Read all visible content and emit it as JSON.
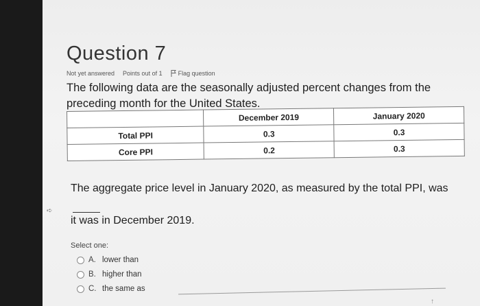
{
  "question": {
    "title": "Question 7",
    "status": "Not yet answered",
    "points": "Points out of 1",
    "flag_label": "Flag question",
    "statement": "The following data are the seasonally adjusted percent changes from the preceding month for the United States."
  },
  "table": {
    "headers": [
      "",
      "December 2019",
      "January 2020"
    ],
    "rows": [
      {
        "label": "Total PPI",
        "dec": "0.3",
        "jan": "0.3"
      },
      {
        "label": "Core PPI",
        "dec": "0.2",
        "jan": "0.3"
      }
    ]
  },
  "prompt": {
    "before_blank": "The aggregate price level in January 2020, as measured by the total PPI, was",
    "after_blank": "it was in December 2019."
  },
  "answers": {
    "select_label": "Select one:",
    "options": [
      {
        "letter": "A.",
        "text": "lower than"
      },
      {
        "letter": "B.",
        "text": "higher than"
      },
      {
        "letter": "C.",
        "text": "the same as"
      }
    ]
  }
}
